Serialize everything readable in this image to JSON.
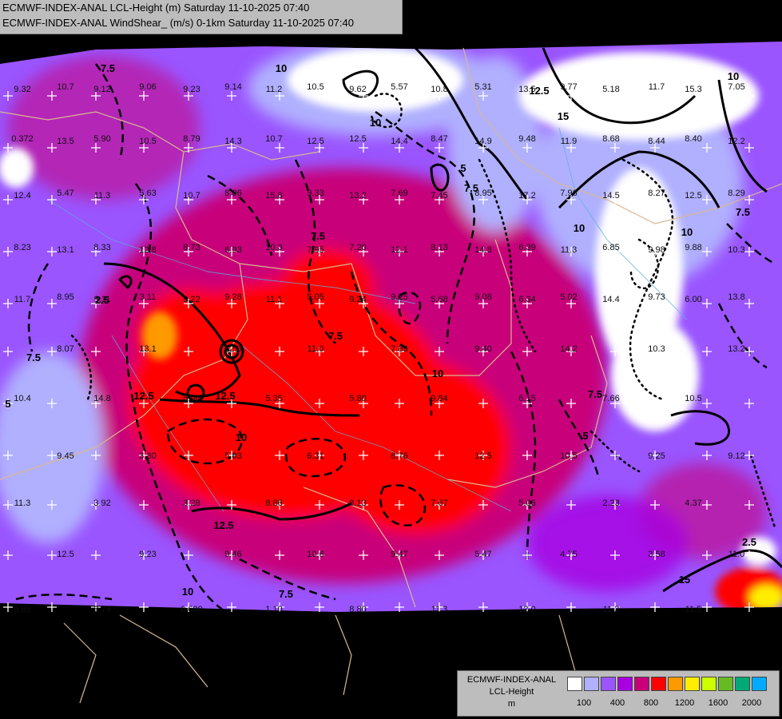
{
  "header": {
    "line1": "ECMWF-INDEX-ANAL LCL-Height (m) Saturday 11-10-2025 07:40",
    "line2": "ECMWF-INDEX-ANAL WindShear_ (m/s) 0-1km Saturday 11-10-2025 07:40"
  },
  "legend": {
    "title_lines": [
      "ECMWF-INDEX-ANAL",
      "LCL-Height",
      "m"
    ],
    "colors": [
      "#ffffff",
      "#b0b0ff",
      "#9a55ff",
      "#a800e0",
      "#c8007a",
      "#ff0000",
      "#ff9900",
      "#ffee00",
      "#ccff00",
      "#66bb22",
      "#00aa77",
      "#00aaff"
    ],
    "tick_labels": [
      "100",
      "400",
      "800",
      "1200",
      "1600",
      "2000"
    ]
  },
  "map": {
    "colors": {
      "ocean": "#000000",
      "border": "#d8b890",
      "river": "#5ab0d8",
      "contour": "#000000"
    },
    "contour_labels": [
      "10",
      "7.5",
      "12.5",
      "15",
      "10",
      "7.5",
      "12.5",
      "10",
      "7.5",
      "10",
      "2.5",
      "7.5",
      "10",
      "5",
      "7.5",
      "12.5",
      "10",
      "7.5",
      "10",
      "5",
      "15",
      "7.5",
      "2.5",
      "10",
      "7.5",
      "12.5",
      "5"
    ],
    "values": [
      "9.32",
      "9.12",
      "9.23",
      "11.2",
      "9.62",
      "10.8",
      "13.5",
      "5.18",
      "15.3",
      "13.5",
      "10.5",
      "14.3",
      "12.5",
      "14.4",
      "14.9",
      "11.9",
      "8.44",
      "12.2",
      "12.4",
      "11.3",
      "10.7",
      "15.8",
      "13.2",
      "7.45",
      "17.2",
      "14.5",
      "12.5",
      "13.1",
      "12.8",
      "6.93",
      "7.95",
      "12.1",
      "14.8",
      "11.3",
      "9.98",
      "10.3",
      "11.7",
      "9.11",
      "9.22",
      "11.1",
      "9.24",
      "5.68",
      "6.34",
      "14.4",
      "6.00",
      "8.07",
      "13.1",
      "12.5",
      "11.0",
      "7.83",
      "9.40",
      "14.2",
      "10.3",
      "13.2",
      "10.4",
      "14.8",
      "6.96",
      "5.35",
      "5.80",
      "9.84",
      "6.15",
      "7.66",
      "10.5",
      "9.45",
      "3.80",
      "5.93",
      "6.31",
      "6.76",
      "12.5",
      "10.5",
      "9.25",
      "9.12",
      "11.3",
      "3.92",
      "3.28",
      "8.86",
      "8.13",
      "7.67",
      "5.06",
      "2.23",
      "4.37",
      "12.5",
      "9.23",
      "9.46",
      "10.6",
      "9.47",
      "5.47",
      "4.75",
      "3.58",
      "11.0",
      "9.95",
      "3.79",
      "0.690",
      "1.10",
      "8.80",
      "11.3",
      "12.0",
      "11.2",
      "11.5",
      "10.7",
      "9.06",
      "9.14",
      "10.5",
      "5.57",
      "5.31",
      "9.77",
      "11.7",
      "7.05",
      "0.372",
      "5.90",
      "8.79",
      "10.7",
      "12.5",
      "8.47",
      "9.48",
      "8.68",
      "8.40",
      "5.47",
      "5.63",
      "8.06",
      "9.33",
      "7.69",
      "8.95",
      "7.96",
      "8.27",
      "8.29",
      "8.23",
      "8.33",
      "8.73",
      "10.3",
      "7.20",
      "8.13",
      "6.39",
      "6.85",
      "9.88",
      "8.95",
      "3.11",
      "9.28",
      "5.05",
      "9.25",
      "9.08",
      "5.02",
      "9.73",
      "13.8"
    ]
  }
}
